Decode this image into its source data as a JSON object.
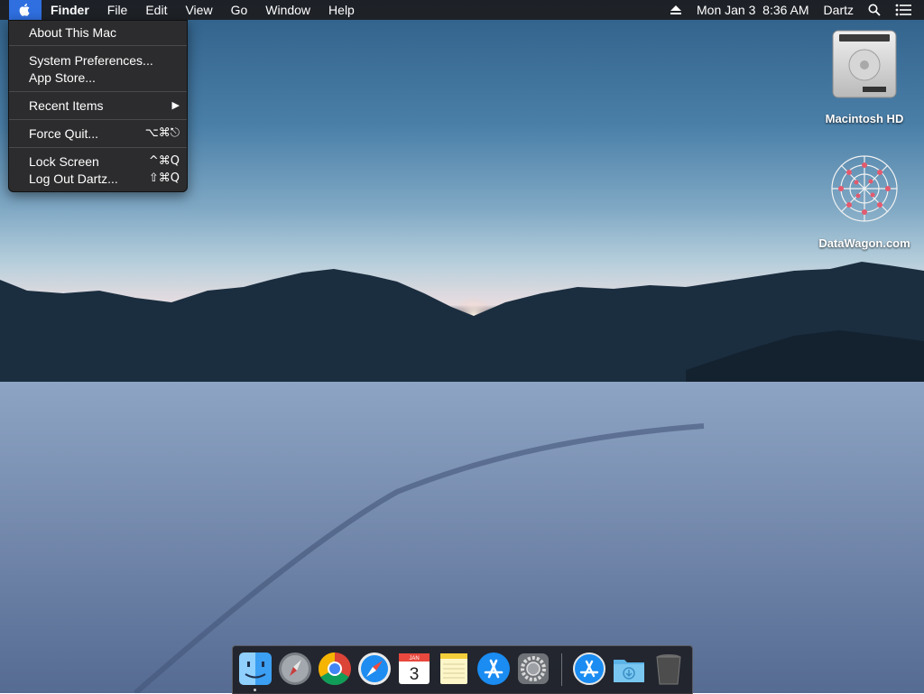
{
  "menubar": {
    "app_name": "Finder",
    "menus": [
      "File",
      "Edit",
      "View",
      "Go",
      "Window",
      "Help"
    ],
    "clock": "Mon Jan 3  8:36 AM",
    "user": "Dartz",
    "status_icons": [
      "eject-icon",
      "spotlight-search-icon",
      "notification-center-icon"
    ]
  },
  "apple_menu": {
    "items": [
      {
        "label": "About This Mac",
        "shortcut": ""
      },
      {
        "label": "System Preferences...",
        "shortcut": ""
      },
      {
        "label": "App Store...",
        "shortcut": ""
      },
      {
        "label": "Recent Items",
        "shortcut": "▶"
      },
      {
        "label": "Force Quit...",
        "shortcut": "⌥⌘⎋"
      },
      {
        "label": "Lock Screen",
        "shortcut": "^⌘Q"
      },
      {
        "label": "Log Out Dartz...",
        "shortcut": "⇧⌘Q"
      }
    ]
  },
  "desktop": {
    "icons": [
      {
        "label": "Macintosh HD",
        "icon": "hard-drive-icon"
      },
      {
        "label": "DataWagon.com",
        "icon": "datawagon-logo-icon"
      }
    ]
  },
  "dock": {
    "apps": [
      "finder-icon",
      "launchpad-icon",
      "chrome-icon",
      "safari-icon",
      "calendar-icon",
      "notes-icon",
      "app-store-icon",
      "system-preferences-icon"
    ],
    "calendar_day": "3",
    "calendar_month": "JAN",
    "right_items": [
      "app-store-download-icon",
      "downloads-folder-icon",
      "trash-icon"
    ]
  },
  "colors": {
    "menubar_bg": "#1c1c1e",
    "selected_blue": "#2f6fe0",
    "menu_bg": "#2c2c2e"
  }
}
